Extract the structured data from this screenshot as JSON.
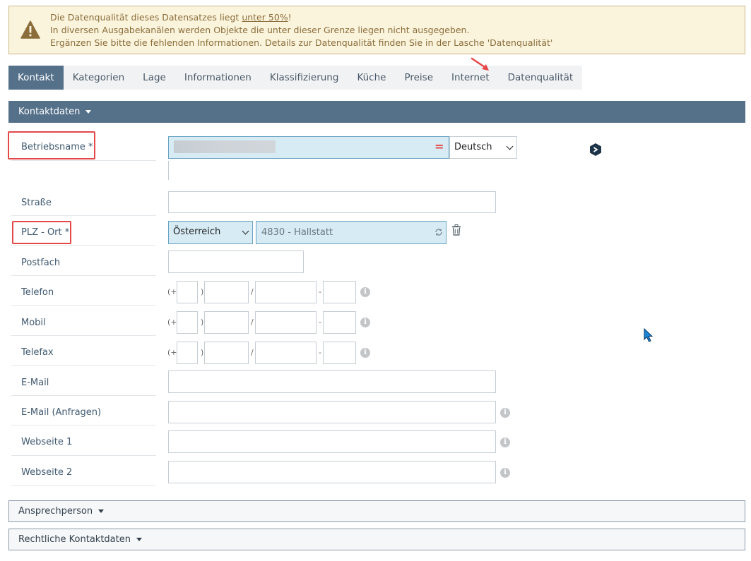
{
  "warning": {
    "line1_pre": "Die Datenqualität dieses Datensatzes liegt ",
    "line1_link": "unter 50%",
    "line1_post": "!",
    "line2": "In diversen Ausgabekanälen werden Objekte die unter dieser Grenze liegen nicht ausgegeben.",
    "line3": "Ergänzen Sie bitte die fehlenden Informationen. Details zur Datenqualität finden Sie in der Lasche 'Datenqualität'"
  },
  "tabs": [
    "Kontakt",
    "Kategorien",
    "Lage",
    "Informationen",
    "Klassifizierung",
    "Küche",
    "Preise",
    "Internet",
    "Datenqualität"
  ],
  "sections": {
    "kontakt": "Kontaktdaten",
    "ansprechperson": "Ansprechperson",
    "rechtlich": "Rechtliche Kontaktdaten"
  },
  "fields": {
    "betriebsname": {
      "label": "Betriebsname *",
      "equals_mark": "=",
      "language": "Deutsch"
    },
    "strasse": {
      "label": "Straße"
    },
    "plz_ort": {
      "label": "PLZ - Ort *",
      "country": "Österreich",
      "value": "4830 - Hallstatt"
    },
    "postfach": {
      "label": "Postfach"
    },
    "telefon": {
      "label": "Telefon"
    },
    "mobil": {
      "label": "Mobil"
    },
    "telefax": {
      "label": "Telefax"
    },
    "email": {
      "label": "E-Mail"
    },
    "email_anfragen": {
      "label": "E-Mail (Anfragen)"
    },
    "webseite1": {
      "label": "Webseite 1"
    },
    "webseite2": {
      "label": "Webseite 2"
    }
  },
  "phone_symbols": {
    "open": "(+",
    "close": ")",
    "slash": "/",
    "dash": "-"
  },
  "info_glyph": "i",
  "colors": {
    "accent": "#55718a",
    "warning_bg": "#fbf4dc",
    "highlight": "#e54848",
    "field_highlight": "#d6ebf4"
  },
  "icons": [
    "warning-icon",
    "refresh-icon",
    "trash-icon",
    "translate-icon",
    "info-icon",
    "annotation-arrow",
    "mouse-cursor"
  ]
}
